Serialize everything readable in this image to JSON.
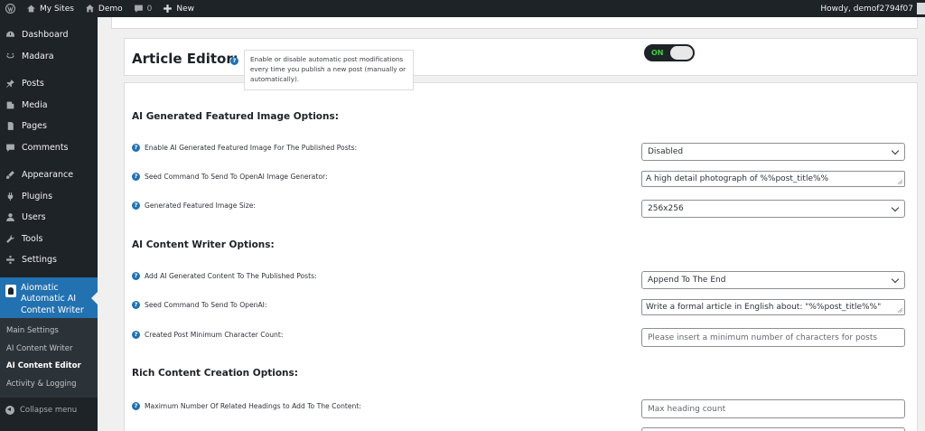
{
  "admin_bar": {
    "my_sites": "My Sites",
    "site_name": "Demo",
    "comments_count": "0",
    "new_label": "New",
    "howdy": "Howdy, demof2794f07"
  },
  "sidebar": {
    "items": [
      {
        "label": "Dashboard",
        "icon": "dashboard-icon"
      },
      {
        "label": "Madara",
        "icon": "madara-icon"
      },
      {
        "label": "Posts",
        "icon": "pin-icon"
      },
      {
        "label": "Media",
        "icon": "media-icon"
      },
      {
        "label": "Pages",
        "icon": "pages-icon"
      },
      {
        "label": "Comments",
        "icon": "comment-icon"
      },
      {
        "label": "Appearance",
        "icon": "brush-icon"
      },
      {
        "label": "Plugins",
        "icon": "plugin-icon"
      },
      {
        "label": "Users",
        "icon": "users-icon"
      },
      {
        "label": "Tools",
        "icon": "wrench-icon"
      },
      {
        "label": "Settings",
        "icon": "settings-icon"
      }
    ],
    "active": "Aiomatic Automatic AI Content Writer",
    "submenu": [
      "Main Settings",
      "AI Content Writer",
      "AI Content Editor",
      "Activity & Logging"
    ],
    "collapse": "Collapse menu"
  },
  "header": {
    "title": "Article Editor:",
    "tooltip": "Enable or disable automatic post modifications every time you publish a new post (manually or automatically).",
    "toggle": "ON"
  },
  "sections": {
    "image": "AI Generated Featured Image Options:",
    "content": "AI Content Writer Options:",
    "rich": "Rich Content Creation Options:"
  },
  "rows": {
    "enable_image": {
      "label": "Enable AI Generated Featured Image For The Published Posts:",
      "value": "Disabled"
    },
    "seed_image": {
      "label": "Seed Command To Send To OpenAI Image Generator:",
      "value": "A high detail photograph of %%post_title%%"
    },
    "image_size": {
      "label": "Generated Featured Image Size:",
      "value": "256x256"
    },
    "add_content": {
      "label": "Add AI Generated Content To The Published Posts:",
      "value": "Append To The End"
    },
    "seed_content": {
      "label": "Seed Command To Send To OpenAI:",
      "value": "Write a formal article in English about: \"%%post_title%%\""
    },
    "min_chars": {
      "label": "Created Post Minimum Character Count:",
      "placeholder": "Please insert a minimum number of characters for posts"
    },
    "max_headings": {
      "label": "Maximum Number Of Related Headings to Add To The Content:",
      "placeholder": "Max heading count"
    }
  },
  "colors": {
    "accent": "#2271b1",
    "toggle_on": "#3ed13e",
    "admin_bg": "#1d2327"
  }
}
